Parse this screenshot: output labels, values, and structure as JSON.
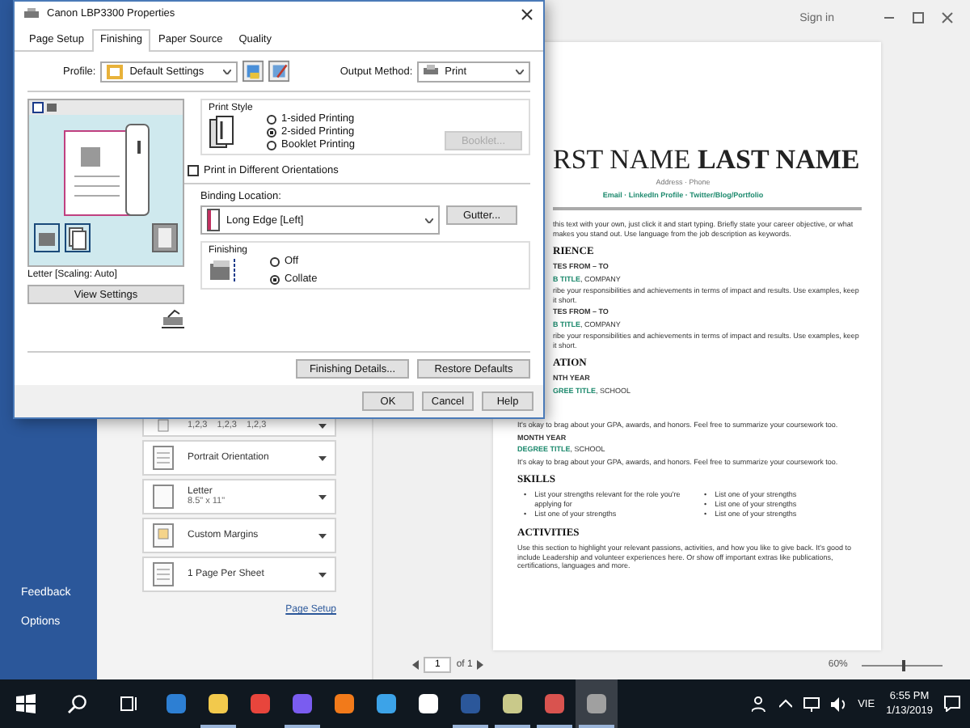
{
  "word": {
    "top_bar": {
      "sign_in": "Sign in"
    },
    "sidebar": {
      "items": [
        "Feedback",
        "Options"
      ]
    },
    "print_settings": [
      {
        "kind": "collate",
        "parts": [
          "1,2,3",
          "1,2,3",
          "1,2,3"
        ]
      },
      {
        "kind": "orientation",
        "title": "Portrait Orientation"
      },
      {
        "kind": "paper",
        "title": "Letter",
        "subtitle": "8.5\" x 11\""
      },
      {
        "kind": "margins",
        "title": "Custom Margins"
      },
      {
        "kind": "pages",
        "title": "1 Page Per Sheet"
      }
    ],
    "page_setup_link": "Page Setup",
    "document": {
      "blocks": [
        {
          "kind": "name",
          "text": "RST NAME **LAST NAME**"
        },
        {
          "kind": "contact",
          "text": "Address · Phone"
        },
        {
          "kind": "links",
          "text": "Email · LinkedIn Profile · Twitter/Blog/Portfolio"
        },
        {
          "kind": "rule"
        },
        {
          "kind": "para",
          "text": "this text with your own, just click it and start typing. Briefly state your career objective, or what makes you stand out. Use language from the job description as keywords."
        },
        {
          "kind": "section",
          "text": "RIENCE"
        },
        {
          "kind": "meta",
          "text": "TES FROM – TO"
        },
        {
          "kind": "title",
          "text": "**B TITLE**, COMPANY"
        },
        {
          "kind": "para",
          "text": "ribe your responsibilities and achievements in terms of impact and results. Use examples, keep it short."
        },
        {
          "kind": "meta",
          "text": "TES FROM – TO"
        },
        {
          "kind": "title",
          "text": "**B TITLE**, COMPANY"
        },
        {
          "kind": "para",
          "text": "ribe your responsibilities and achievements in terms of impact and results. Use examples, keep it short."
        },
        {
          "kind": "section",
          "text": "ATION"
        },
        {
          "kind": "meta",
          "text": "NTH YEAR"
        },
        {
          "kind": "title",
          "text": "**GREE TITLE**, SCHOOL"
        }
      ],
      "blocks_below_dialog": [
        {
          "kind": "para",
          "text": "It's okay to brag about your GPA, awards, and honors. Feel free to summarize your coursework too."
        },
        {
          "kind": "meta",
          "text": "MONTH YEAR"
        },
        {
          "kind": "title",
          "text": "**DEGREE TITLE**, SCHOOL"
        },
        {
          "kind": "para",
          "text": "It's okay to brag about your GPA, awards, and honors. Feel free to summarize your coursework too."
        },
        {
          "kind": "section",
          "text": "SKILLS"
        },
        {
          "kind": "bullets",
          "marker": "•",
          "columns": [
            [
              "List your strengths relevant for the role you're applying for",
              "List one of your strengths"
            ],
            [
              "List one of your strengths",
              "List one of your strengths",
              "List one of your strengths"
            ]
          ]
        },
        {
          "kind": "section",
          "text": "ACTIVITIES"
        },
        {
          "kind": "para",
          "text": "Use this section to highlight your relevant passions, activities, and how you like to give back. It's good to include Leadership and volunteer experiences here. Or show off important extras like publications, certifications, languages and more."
        }
      ]
    },
    "page_nav": {
      "page": "1",
      "total": "of 1"
    },
    "zoom": {
      "label": "60%",
      "level": 0.5
    }
  },
  "dialog": {
    "title": "Canon LBP3300 Properties",
    "tabs": [
      {
        "label": "Page Setup",
        "selected": false
      },
      {
        "label": "Finishing",
        "selected": true
      },
      {
        "label": "Paper Source",
        "selected": false
      },
      {
        "label": "Quality",
        "selected": false
      }
    ],
    "profile": {
      "label": "Profile:",
      "value": "Default Settings"
    },
    "output_method": {
      "label": "Output Method:",
      "value": "Print"
    },
    "preview": {
      "caption": "Letter [Scaling: Auto]",
      "button": "View Settings"
    },
    "print_style": {
      "title": "Print Style",
      "options": [
        {
          "label": "1-sided Printing",
          "selected": false
        },
        {
          "label": "2-sided Printing",
          "selected": true
        },
        {
          "label": "Booklet Printing",
          "selected": false
        }
      ],
      "booklet_button": {
        "label": "Booklet...",
        "disabled": true
      }
    },
    "orientation_checkbox": {
      "label": "Print in Different Orientations",
      "checked": false
    },
    "binding": {
      "label": "Binding Location:",
      "value": "Long Edge [Left]",
      "button": "Gutter..."
    },
    "finishing": {
      "title": "Finishing",
      "options": [
        {
          "label": "Off",
          "selected": false
        },
        {
          "label": "Collate",
          "selected": true
        }
      ]
    },
    "action_buttons": [
      "Finishing Details...",
      "Restore Defaults"
    ],
    "footer_buttons": [
      "OK",
      "Cancel",
      "Help"
    ]
  },
  "taskbar": {
    "apps": [
      {
        "open": false,
        "selected": false
      },
      {
        "open": true,
        "selected": false
      },
      {
        "open": false,
        "selected": false
      },
      {
        "open": true,
        "selected": false
      },
      {
        "open": false,
        "selected": false
      },
      {
        "open": false,
        "selected": false
      },
      {
        "open": false,
        "selected": false
      },
      {
        "open": true,
        "selected": false
      },
      {
        "open": true,
        "selected": false
      },
      {
        "open": true,
        "selected": false
      },
      {
        "open": true,
        "selected": true
      }
    ],
    "language": "VIE",
    "time": "6:55 PM",
    "date": "1/13/2019"
  }
}
